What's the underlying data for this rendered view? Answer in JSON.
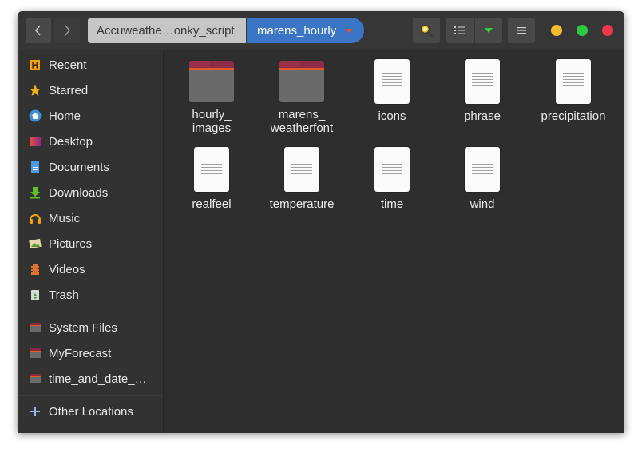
{
  "header": {
    "back_icon": "chevron-left-icon",
    "forward_icon": "chevron-right-icon",
    "breadcrumb_parent": "Accuweathe…onky_script",
    "breadcrumb_current": "marens_hourly",
    "search_icon": "search-icon",
    "view_list_icon": "list-view-icon",
    "view_options_icon": "triangle-down-icon",
    "menu_icon": "hamburger-menu-icon",
    "window_controls": {
      "minimize": "#f4bd2c",
      "maximize": "#2ac940",
      "close": "#f0384a"
    }
  },
  "sidebar": {
    "items": [
      {
        "label": "Recent",
        "icon": "recent-icon"
      },
      {
        "label": "Starred",
        "icon": "star-icon"
      },
      {
        "label": "Home",
        "icon": "home-icon"
      },
      {
        "label": "Desktop",
        "icon": "desktop-icon"
      },
      {
        "label": "Documents",
        "icon": "documents-icon"
      },
      {
        "label": "Downloads",
        "icon": "downloads-icon"
      },
      {
        "label": "Music",
        "icon": "music-icon"
      },
      {
        "label": "Pictures",
        "icon": "pictures-icon"
      },
      {
        "label": "Videos",
        "icon": "videos-icon"
      },
      {
        "label": "Trash",
        "icon": "trash-icon"
      }
    ],
    "devices": [
      {
        "label": "System Files",
        "icon": "drive-icon"
      },
      {
        "label": "MyForecast",
        "icon": "drive-icon"
      },
      {
        "label": "time_and_date_…",
        "icon": "drive-icon"
      }
    ],
    "other": {
      "label": "Other Locations",
      "icon": "plus-icon"
    }
  },
  "files": [
    {
      "name_line1": "hourly_",
      "name_line2": "images",
      "type": "folder"
    },
    {
      "name_line1": "marens_",
      "name_line2": "weatherfont",
      "type": "folder"
    },
    {
      "name_line1": "icons",
      "name_line2": "",
      "type": "document"
    },
    {
      "name_line1": "phrase",
      "name_line2": "",
      "type": "document"
    },
    {
      "name_line1": "precipitation",
      "name_line2": "",
      "type": "document"
    },
    {
      "name_line1": "realfeel",
      "name_line2": "",
      "type": "document"
    },
    {
      "name_line1": "temperature",
      "name_line2": "",
      "type": "document"
    },
    {
      "name_line1": "time",
      "name_line2": "",
      "type": "document"
    },
    {
      "name_line1": "wind",
      "name_line2": "",
      "type": "document"
    }
  ],
  "colors": {
    "accent": "#3a76c5",
    "orange": "#e95420"
  }
}
